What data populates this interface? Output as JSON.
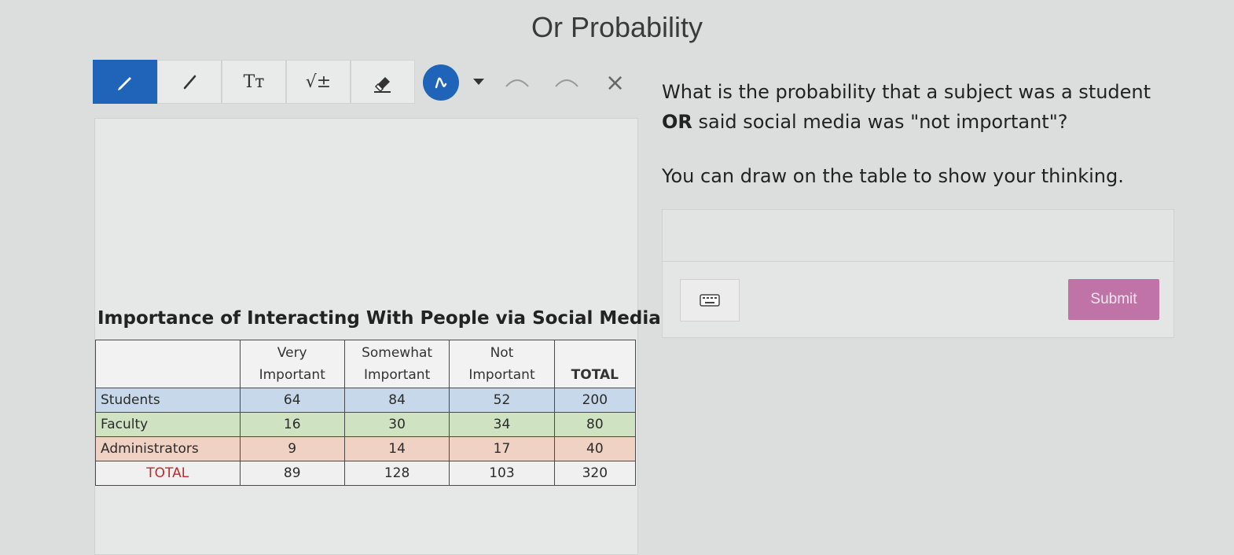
{
  "page": {
    "title": "Or Probability"
  },
  "toolbar": {
    "tools": [
      {
        "name": "pen-tool",
        "icon": "pencil-icon",
        "active": true
      },
      {
        "name": "line-tool",
        "icon": "line-icon",
        "active": false
      },
      {
        "name": "text-tool",
        "icon": "text-size-icon",
        "label": "Tт",
        "active": false
      },
      {
        "name": "math-tool",
        "icon": "square-root-icon",
        "label": "√±",
        "active": false
      },
      {
        "name": "eraser-tool",
        "icon": "eraser-icon",
        "active": false
      }
    ],
    "color_selected": "#1f64b8"
  },
  "question": {
    "text_part1": "What is the probability that a subject was a student",
    "bold_word": "OR",
    "text_part2": " said social media was \"not important\"?",
    "hint": "You can draw on the table to show your thinking."
  },
  "table": {
    "title": "Importance of Interacting With People via Social Media",
    "headers": [
      "",
      "Very\nImportant",
      "Somewhat\nImportant",
      "Not\nImportant",
      "TOTAL"
    ],
    "rows": [
      {
        "label": "Students",
        "values": [
          "64",
          "84",
          "52",
          "200"
        ]
      },
      {
        "label": "Faculty",
        "values": [
          "16",
          "30",
          "34",
          "80"
        ]
      },
      {
        "label": "Administrators",
        "values": [
          "9",
          "14",
          "17",
          "40"
        ]
      },
      {
        "label": "TOTAL",
        "values": [
          "89",
          "128",
          "103",
          "320"
        ]
      }
    ]
  },
  "answer": {
    "value": "",
    "submit_label": "Submit"
  },
  "colors": {
    "accent": "#1f64b8",
    "submit": "#c073a6",
    "total_red": "#c0282c"
  }
}
